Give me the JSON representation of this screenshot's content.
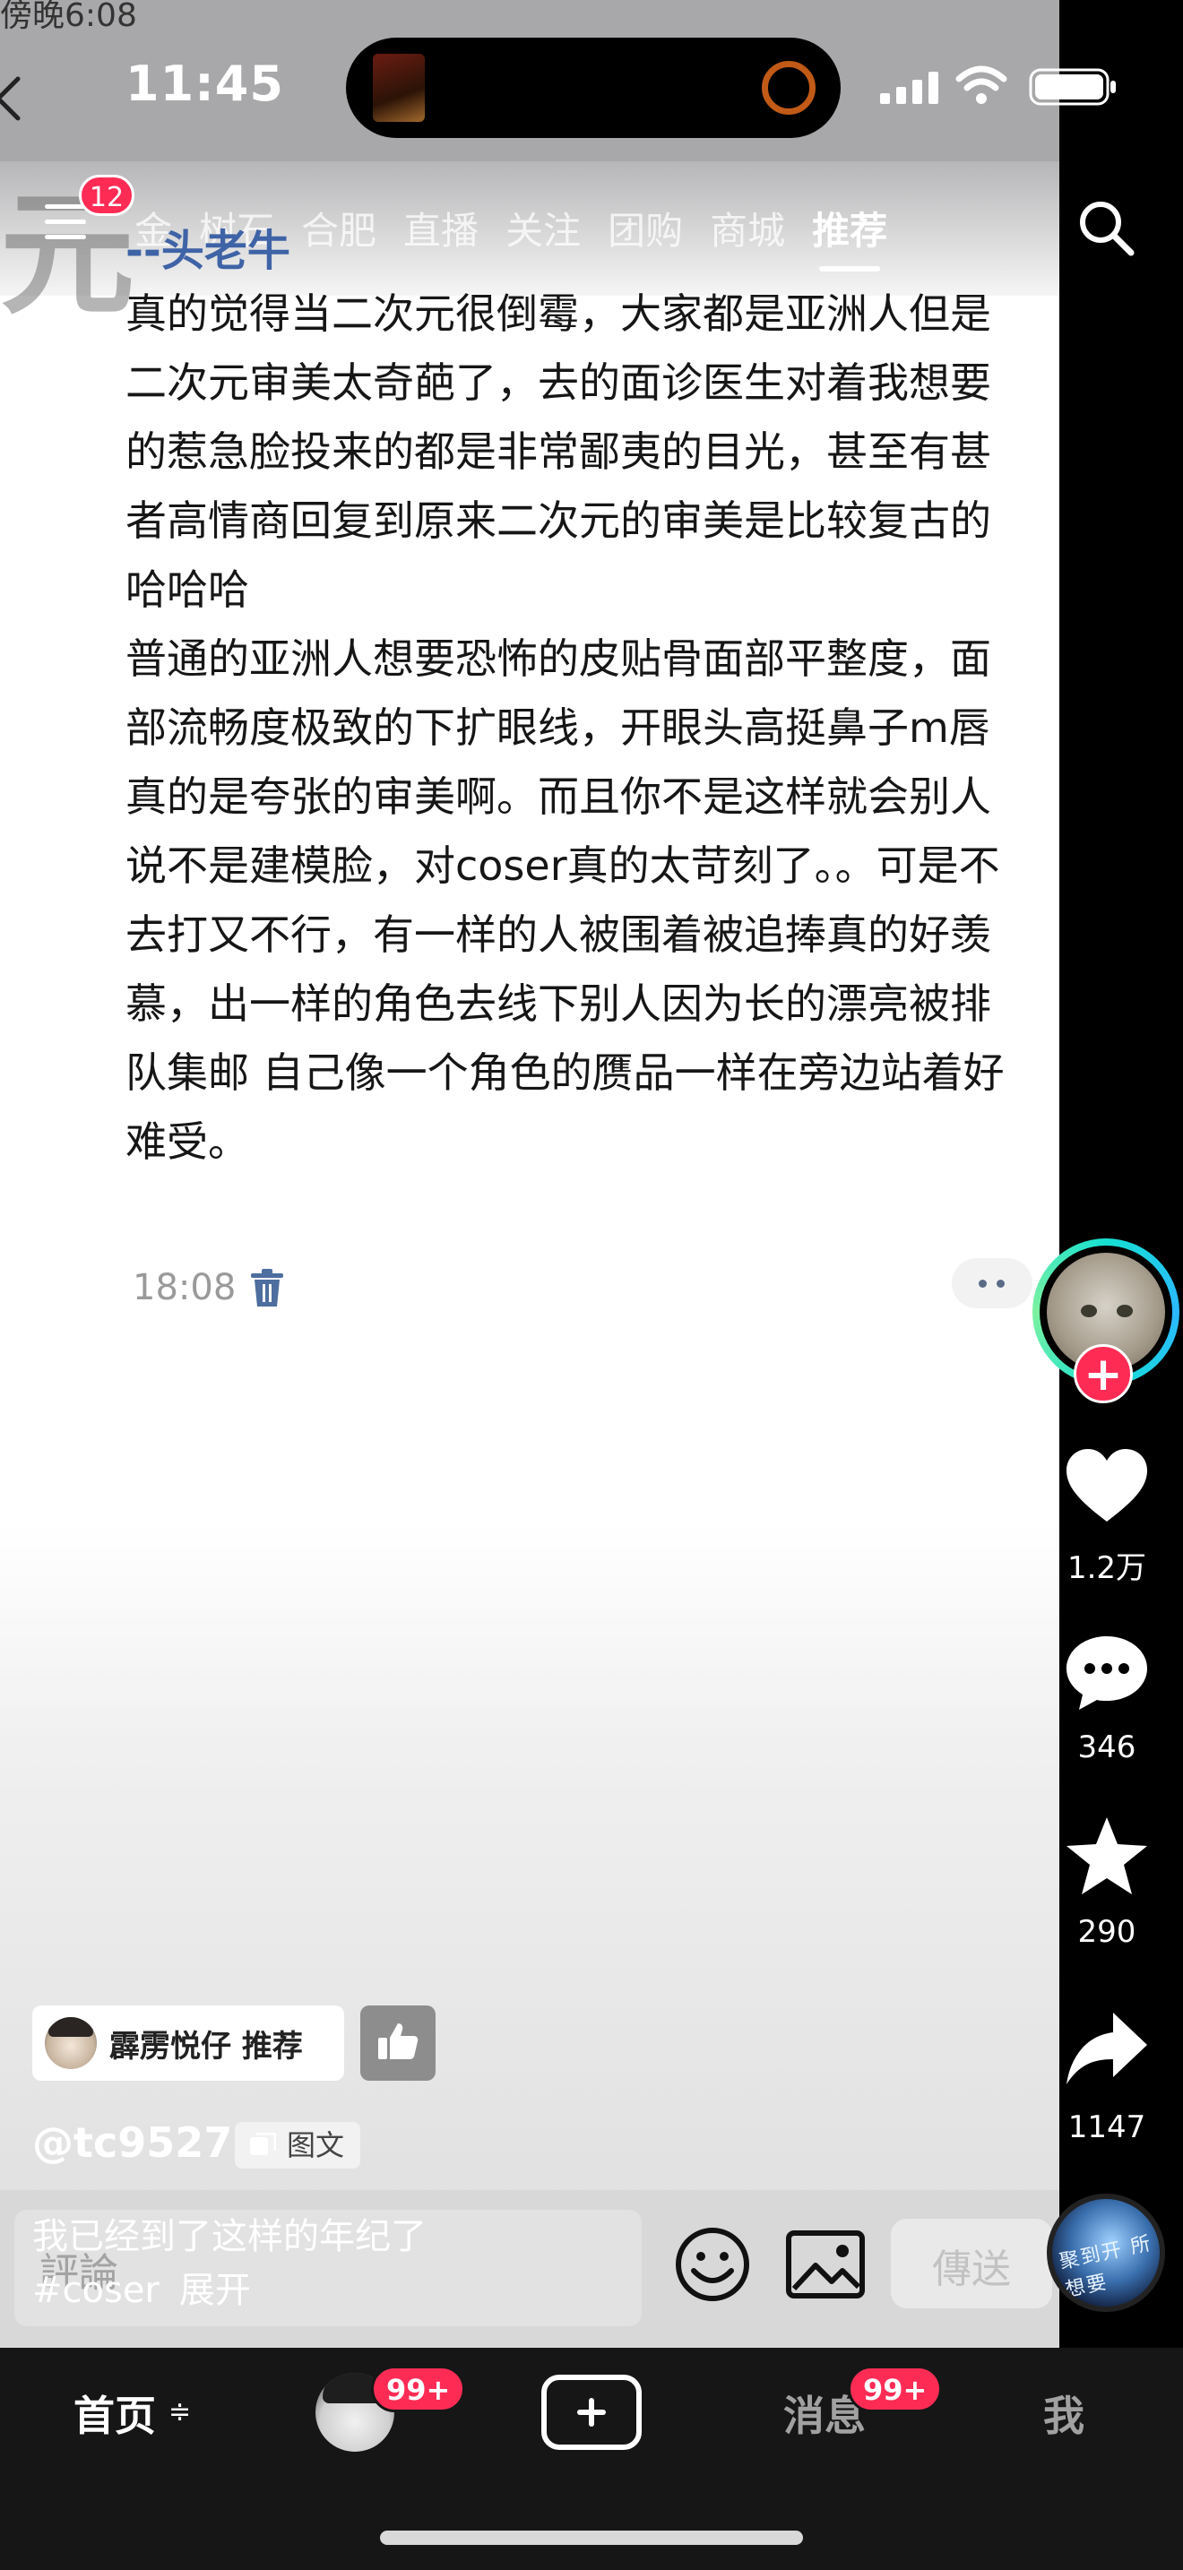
{
  "status_bar": {
    "time": "11:45",
    "top_partial_text": "傍晚6:08"
  },
  "nav": {
    "menu_badge": "12",
    "tabs": [
      "金",
      "树石",
      "合肥",
      "直播",
      "关注",
      "团购",
      "商城",
      "推荐"
    ],
    "active_tab": "推荐",
    "background_glyph": "元"
  },
  "post": {
    "author": "--头老牛",
    "paragraph_1": "真的觉得当二次元很倒霉，大家都是亚洲人但是二次元审美太奇葩了，去的面诊医生对着我想要的惹急脸投来的都是非常鄙夷的目光，甚至有甚者高情商回复到原来二次元的审美是比较复古的哈哈哈",
    "paragraph_2": "普通的亚洲人想要恐怖的皮贴骨面部平整度，面部流畅度极致的下扩眼线，开眼头高挺鼻子m唇真的是夸张的审美啊。而且你不是这样就会别人说不是建模脸，对coser真的太苛刻了。。可是不去打又不行，有一样的人被围着被追捧真的好羡慕，出一样的角色去线下别人因为长的漂亮被排队集邮 自己像一个角色的赝品一样在旁边站着好难受。",
    "time": "18:08"
  },
  "actions": {
    "likes": "1.2万",
    "comments": "346",
    "favorites": "290",
    "shares": "1147"
  },
  "overlay": {
    "recommender": "霹雳悦仔 推荐",
    "handle": "@tc9527",
    "type_tag": "图文",
    "caption_line_1": "我已经到了这样的年纪了",
    "hashtag": "#coser",
    "expand": "展开",
    "comment_placeholder": "評論",
    "send_label": "傳送",
    "music_text": "聚到开 所想要"
  },
  "tabbar": {
    "home": "首页",
    "home_refresh": "≑",
    "friends_badge": "99+",
    "messages": "消息",
    "messages_badge": "99+",
    "me": "我"
  }
}
